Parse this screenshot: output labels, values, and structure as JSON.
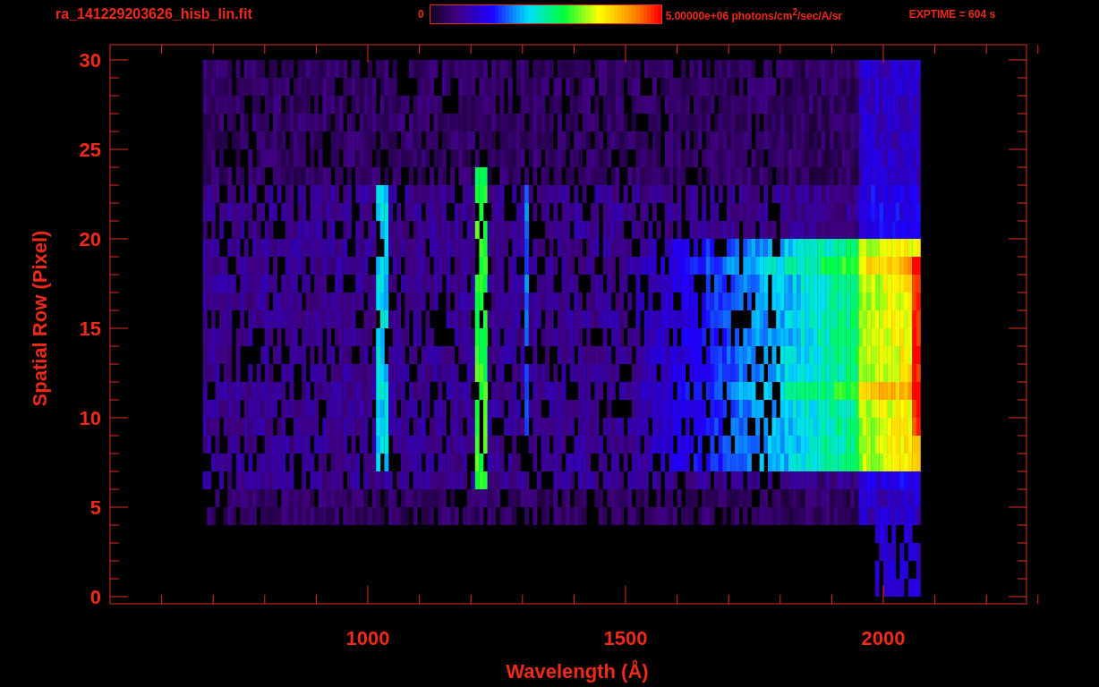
{
  "title": "ra_141229203626_hisb_lin.fit",
  "colorbar": {
    "min_label": "0",
    "max_label": "5.00000e+06 photons/cm$^{2}$/sec/A/sr"
  },
  "exposure": "EXPTIME = 604 s",
  "y_axis": {
    "label": "Spatial Row (Pixel)",
    "ticks": [
      "30",
      "25",
      "20",
      "15",
      "10",
      "5",
      "0"
    ]
  },
  "x_axis": {
    "label": "Wavelength (Å)",
    "ticks": [
      "1000",
      "1500",
      "2000"
    ]
  }
}
